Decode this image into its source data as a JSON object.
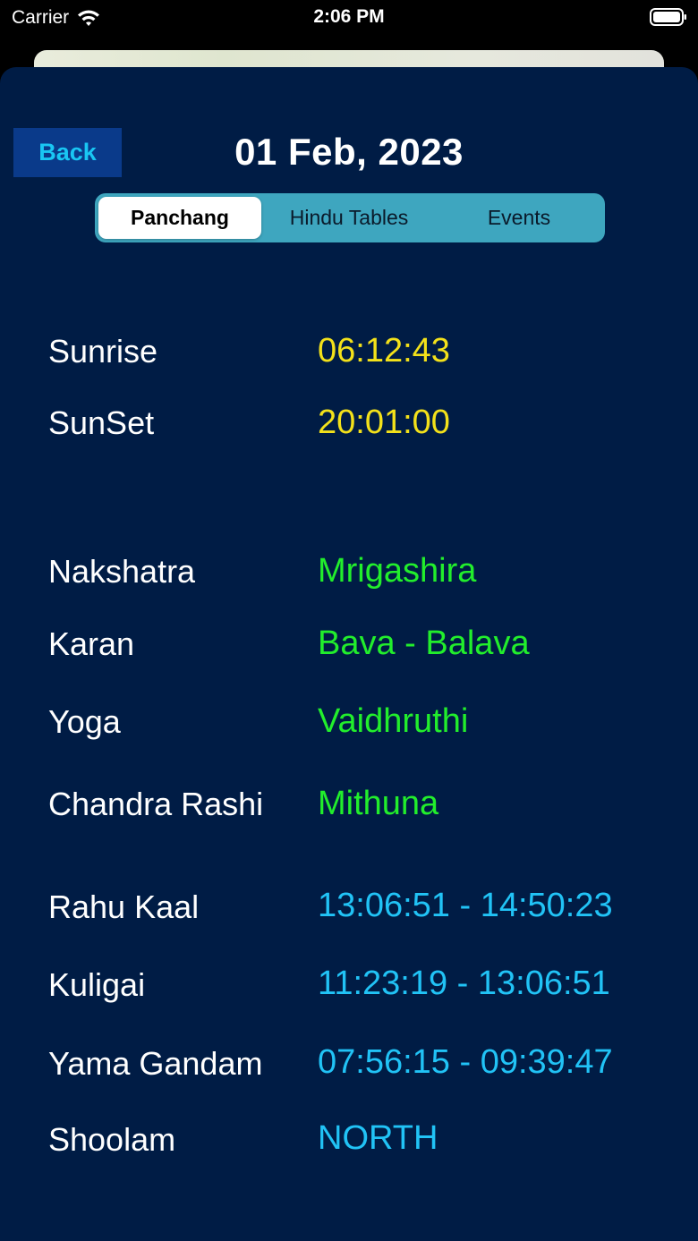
{
  "status_bar": {
    "carrier": "Carrier",
    "time": "2:06 PM",
    "wifi_icon": "wifi-icon",
    "battery_icon": "battery-icon"
  },
  "header": {
    "back_label": "Back",
    "date_title": "01 Feb, 2023"
  },
  "tabs": {
    "selected": "Panchang",
    "items": [
      {
        "label": "Panchang"
      },
      {
        "label": "Hindu Tables"
      },
      {
        "label": "Events"
      }
    ]
  },
  "sun": {
    "sunrise_label": "Sunrise",
    "sunrise_value": "06:12:43",
    "sunset_label": "SunSet",
    "sunset_value": "20:01:00"
  },
  "panchang": {
    "nakshatra_label": "Nakshatra",
    "nakshatra_value": "Mrigashira",
    "karan_label": "Karan",
    "karan_value": "Bava - Balava",
    "yoga_label": "Yoga",
    "yoga_value": "Vaidhruthi",
    "chandra_rashi_label": "Chandra Rashi",
    "chandra_rashi_value": "Mithuna"
  },
  "timings": {
    "rahu_kaal_label": "Rahu Kaal",
    "rahu_kaal_value": "13:06:51 - 14:50:23",
    "kuligai_label": "Kuligai",
    "kuligai_value": "11:23:19 - 13:06:51",
    "yama_gandam_label": "Yama Gandam",
    "yama_gandam_value": "07:56:15 - 09:39:47",
    "shoolam_label": "Shoolam",
    "shoolam_value": "NORTH"
  },
  "colors": {
    "background": "#001c45",
    "sun_value": "#f3e11a",
    "panchang_value": "#22ee2c",
    "timing_value": "#21c3f6",
    "back_button": "#0a3a8a",
    "segment_track": "#3ea6bf"
  }
}
